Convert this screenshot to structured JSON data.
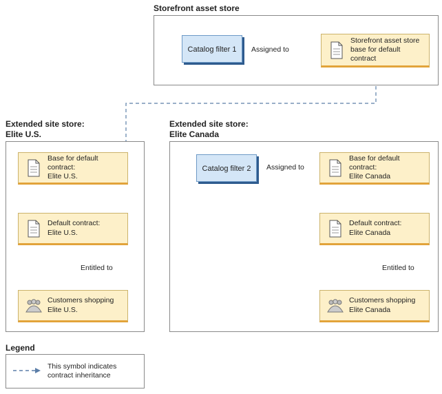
{
  "storefront": {
    "title": "Storefront asset store",
    "filter_label": "Catalog filter 1",
    "assigned_label": "Assigned to",
    "base_contract_label": "Storefront asset store base for default contract"
  },
  "us": {
    "title": "Extended site store:\nElite U.S.",
    "base_contract": "Base for default contract:\nElite U.S.",
    "default_contract": "Default contract:\nElite U.S.",
    "entitled_label": "Entitled to",
    "customers": "Customers shopping\nElite U.S."
  },
  "ca": {
    "title": "Extended site store:\nElite Canada",
    "filter_label": "Catalog filter 2",
    "assigned_label": "Assigned to",
    "base_contract": "Base for default contract:\nElite Canada",
    "default_contract": "Default contract:\nElite Canada",
    "entitled_label": "Entitled to",
    "customers": "Customers shopping\nElite Canada"
  },
  "legend": {
    "title": "Legend",
    "text": "This symbol indicates contract inheritance"
  }
}
